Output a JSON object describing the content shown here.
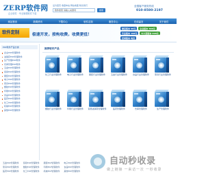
{
  "header": {
    "logo_text": "ZERP软件网",
    "logo_sub": "企业软件 · 专业管理软件下载",
    "top_links": "设为首页 收藏本站 网站地图 联系我们",
    "search_value": "软件搜索 请输入关键词",
    "search_button": "搜索",
    "hotline_label": "全国客户服务热线",
    "hotline_number": "010-8580-2197"
  },
  "nav": [
    "网站首页",
    "新闻资讯",
    "下载中心",
    "软件定制",
    "服务中心",
    "在线留言",
    "关于我们"
  ],
  "banner": {
    "badge": "软件定制",
    "slogan": "极速开发，按构收费，收费更低！",
    "versions": [
      {
        "label": "便宜版本",
        "price": "98元",
        "label2": "企业版本",
        "price2": "398元"
      },
      {
        "label": "专业版本",
        "price": "198元",
        "label2": "中大型版本",
        "price2": "698元"
      },
      {
        "label": "定制版本",
        "price": "电议"
      }
    ]
  },
  "sidebar": {
    "heading": "ERP软件产品分类",
    "items": [
      "企业ERP管理软件",
      "进销存ERP管理软件",
      "生产管理ERP软件",
      "仓库管理ERP软件",
      "五金ERP管理软件",
      "贸易ERP管理软件",
      "服装ERP管理软件",
      "电子ERP管理软件",
      "家具ERP管理软件",
      "塑胶ERP管理软件",
      "印刷ERP管理软件",
      "食品ERP管理软件",
      "医药ERP管理软件",
      "化工ERP管理软件",
      "机械ERP管理软件",
      "其他ERP管理软件"
    ]
  },
  "main": {
    "title": "推荐软件产品",
    "products": [
      {
        "name": "化工行业管理软件"
      },
      {
        "name": "电子行业管理软件"
      },
      {
        "name": "服装行业管理软件"
      },
      {
        "name": "五金行业管理软件"
      },
      {
        "name": "食品行业管理软件"
      },
      {
        "name": "家具行业管理软件"
      },
      {
        "name": "塑胶行业管理软件"
      },
      {
        "name": "印刷行业管理软件"
      },
      {
        "name": "贸易进销存管理软件"
      },
      {
        "name": "医药管理软件"
      },
      {
        "name": "仓库管理软件"
      },
      {
        "name": "生产管理软件"
      }
    ]
  },
  "bottom_links": [
    [
      "五金ERP管理软件",
      "贸易ERP管理软件",
      "服装ERP管理软件",
      "电子ERP管理软件"
    ],
    [
      "家具ERP管理软件",
      "塑胶ERP管理软件",
      "印刷ERP管理软件",
      "食品ERP管理软件"
    ],
    [
      "医药ERP管理软件",
      "化工ERP管理软件",
      "机械ERP管理软件",
      "其他ERP管理软件"
    ]
  ],
  "watermark": {
    "title": "自动秒收录",
    "subtitle": "做上链接 一来访一次 一秒收录"
  },
  "colors": {
    "primary": "#1d6fb8",
    "nav": "#2a70bd",
    "badge": "#f5a400"
  }
}
